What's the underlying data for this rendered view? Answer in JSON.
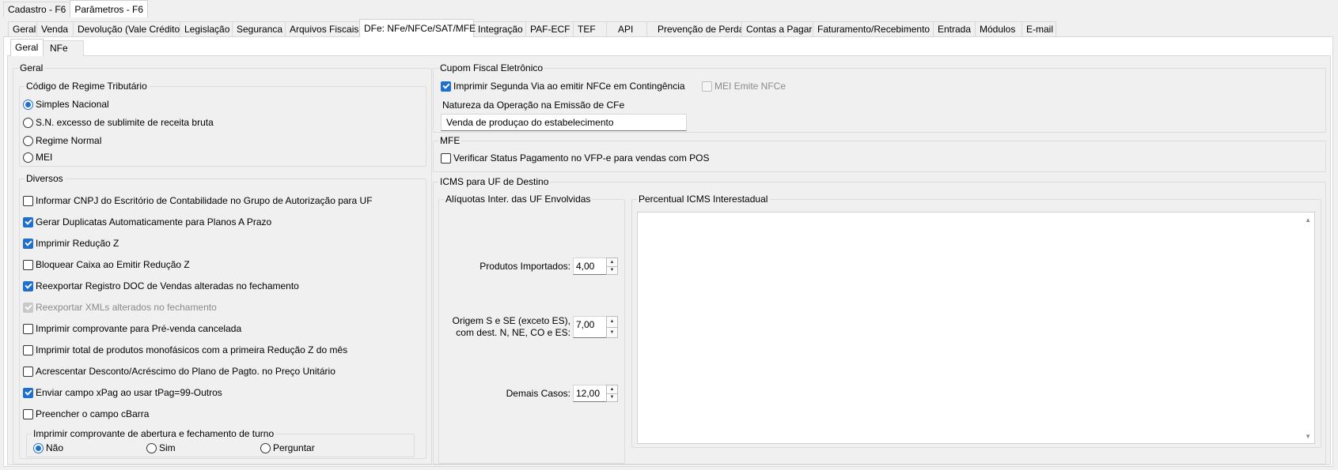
{
  "top_tabs": [
    {
      "label": "Cadastro - F6",
      "active": false
    },
    {
      "label": "Parâmetros - F6",
      "active": true
    }
  ],
  "main_tabs": [
    {
      "label": "Geral"
    },
    {
      "label": "Venda"
    },
    {
      "label": "Devolução (Vale Crédito)"
    },
    {
      "label": "Legislação"
    },
    {
      "label": "Seguranca"
    },
    {
      "label": "Arquivos Fiscais"
    },
    {
      "label": "DFe: NFe/NFCe/SAT/MFE"
    },
    {
      "label": "Integração"
    },
    {
      "label": "PAF-ECF"
    },
    {
      "label": "TEF"
    },
    {
      "label": "API"
    },
    {
      "label": "Prevenção de Perdas"
    },
    {
      "label": "Contas a Pagar"
    },
    {
      "label": "Faturamento/Recebimento"
    },
    {
      "label": "Entrada"
    },
    {
      "label": "Módulos"
    },
    {
      "label": "E-mail"
    }
  ],
  "sub_tabs": [
    {
      "label": "Geral",
      "active": true
    },
    {
      "label": "NFe",
      "active": false
    }
  ],
  "geral": {
    "title": "Geral",
    "regime": {
      "title": "Código de Regime Tributário",
      "options": [
        {
          "label": "Simples Nacional",
          "selected": true
        },
        {
          "label": "S.N. excesso de sublimite de receita bruta",
          "selected": false
        },
        {
          "label": "Regime Normal",
          "selected": false
        },
        {
          "label": "MEI",
          "selected": false
        }
      ]
    },
    "diversos": {
      "title": "Diversos",
      "checks": [
        {
          "label": "Informar CNPJ do Escritório de Contabilidade no Grupo de Autorização para UF",
          "checked": false,
          "disabled": false
        },
        {
          "label": "Gerar Duplicatas Automaticamente para Planos A Prazo",
          "checked": true,
          "disabled": false
        },
        {
          "label": "Imprimir Redução Z",
          "checked": true,
          "disabled": false
        },
        {
          "label": "Bloquear Caixa ao Emitir Redução Z",
          "checked": false,
          "disabled": false
        },
        {
          "label": "Reexportar Registro DOC de Vendas alteradas no fechamento",
          "checked": true,
          "disabled": false
        },
        {
          "label": "Reexportar XMLs alterados no fechamento",
          "checked": true,
          "disabled": true
        },
        {
          "label": "Imprimir comprovante para Pré-venda cancelada",
          "checked": false,
          "disabled": false
        },
        {
          "label": "Imprimir total de produtos monofásicos com a primeira Redução Z do mês",
          "checked": false,
          "disabled": false
        },
        {
          "label": "Acrescentar Desconto/Acréscimo do Plano de Pagto. no Preço Unitário",
          "checked": false,
          "disabled": false
        },
        {
          "label": "Enviar campo xPag ao usar tPag=99-Outros",
          "checked": true,
          "disabled": false
        },
        {
          "label": "Preencher o campo cBarra",
          "checked": false,
          "disabled": false
        }
      ],
      "turno": {
        "title": "Imprimir comprovante de abertura e fechamento de turno",
        "options": [
          {
            "label": "Não",
            "selected": true
          },
          {
            "label": "Sim",
            "selected": false
          },
          {
            "label": "Perguntar",
            "selected": false
          }
        ]
      }
    }
  },
  "cupom": {
    "title": "Cupom Fiscal Eletrônico",
    "segunda_via": {
      "label": "Imprimir Segunda Via ao emitir NFCe em Contingência",
      "checked": true
    },
    "mei_emite": {
      "label": "MEI Emite NFCe",
      "checked": false,
      "disabled": true
    },
    "natureza_label": "Natureza da Operação na Emissão de CFe",
    "natureza_value": "Venda de produçao do estabelecimento"
  },
  "mfe": {
    "title": "MFE",
    "verificar": {
      "label": "Verificar Status Pagamento no VFP-e para vendas com POS",
      "checked": false
    }
  },
  "icms": {
    "title": "ICMS para UF de Destino",
    "aliquotas": {
      "title": "Alíquotas Inter. das UF Envolvidas",
      "produtos_importados": {
        "label": "Produtos Importados:",
        "value": "4,00"
      },
      "origem": {
        "label_line1": "Origem S e SE (exceto ES),",
        "label_line2": "com dest. N, NE, CO e ES:",
        "value": "7,00"
      },
      "demais": {
        "label": "Demais Casos:",
        "value": "12,00"
      }
    },
    "percentual": {
      "title": "Percentual ICMS Interestadual"
    }
  }
}
